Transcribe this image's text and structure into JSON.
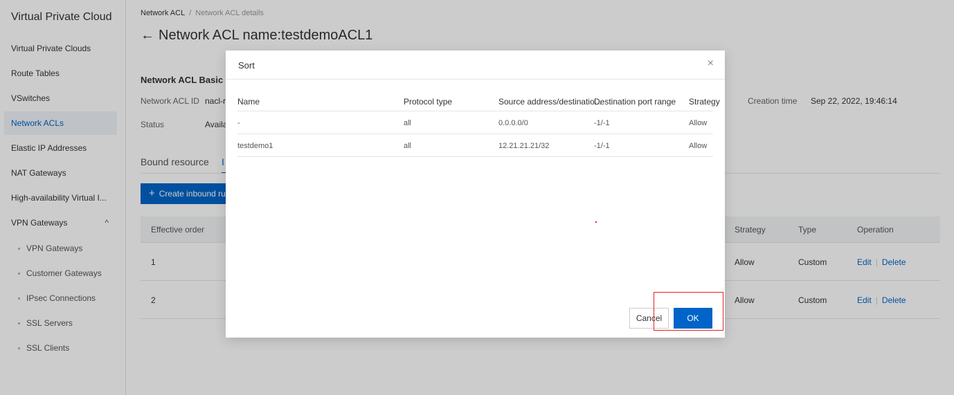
{
  "sidebar": {
    "title": "Virtual Private Cloud",
    "items": [
      {
        "label": "Virtual Private Clouds"
      },
      {
        "label": "Route Tables"
      },
      {
        "label": "VSwitches"
      },
      {
        "label": "Network ACLs"
      },
      {
        "label": "Elastic IP Addresses"
      },
      {
        "label": "NAT Gateways"
      },
      {
        "label": "High-availability Virtual I..."
      },
      {
        "label": "VPN Gateways"
      }
    ],
    "subitems": [
      {
        "label": "VPN Gateways"
      },
      {
        "label": "Customer Gateways"
      },
      {
        "label": "IPsec Connections"
      },
      {
        "label": "SSL Servers"
      },
      {
        "label": "SSL Clients"
      }
    ],
    "caret": "^"
  },
  "breadcrumb": {
    "parent": "Network ACL",
    "separator": "/",
    "current": "Network ACL details"
  },
  "page_title": "Network ACL name:testdemoACL1",
  "back_arrow": "←",
  "basic_info": {
    "title": "Network ACL Basic ir",
    "id_label": "Network ACL ID",
    "id_value": "nacl-r",
    "status_label": "Status",
    "status_value": "Availal",
    "creation_label": "Creation time",
    "creation_value": "Sep 22, 2022, 19:46:14"
  },
  "tabs": {
    "bound": "Bound resource",
    "inbound": "I"
  },
  "create_button": {
    "plus": "+",
    "label": "Create inbound rule"
  },
  "table": {
    "headers": {
      "order": "Effective order",
      "strategy": "Strategy",
      "type": "Type",
      "operation": "Operation"
    },
    "rows": [
      {
        "order": "1",
        "strategy": "Allow",
        "type": "Custom",
        "edit": "Edit",
        "delete": "Delete"
      },
      {
        "order": "2",
        "strategy": "Allow",
        "type": "Custom",
        "edit": "Edit",
        "delete": "Delete"
      }
    ],
    "pipe": "|"
  },
  "dialog": {
    "title": "Sort",
    "close": "×",
    "headers": {
      "name": "Name",
      "protocol": "Protocol type",
      "source": "Source address/destinatio...",
      "port": "Destination port range",
      "strategy": "Strategy"
    },
    "rows": [
      {
        "name": "-",
        "protocol": "all",
        "source": "0.0.0.0/0",
        "port": "-1/-1",
        "strategy": "Allow"
      },
      {
        "name": "testdemo1",
        "protocol": "all",
        "source": "12.21.21.21/32",
        "port": "-1/-1",
        "strategy": "Allow"
      }
    ],
    "cancel": "Cancel",
    "ok": "OK"
  }
}
